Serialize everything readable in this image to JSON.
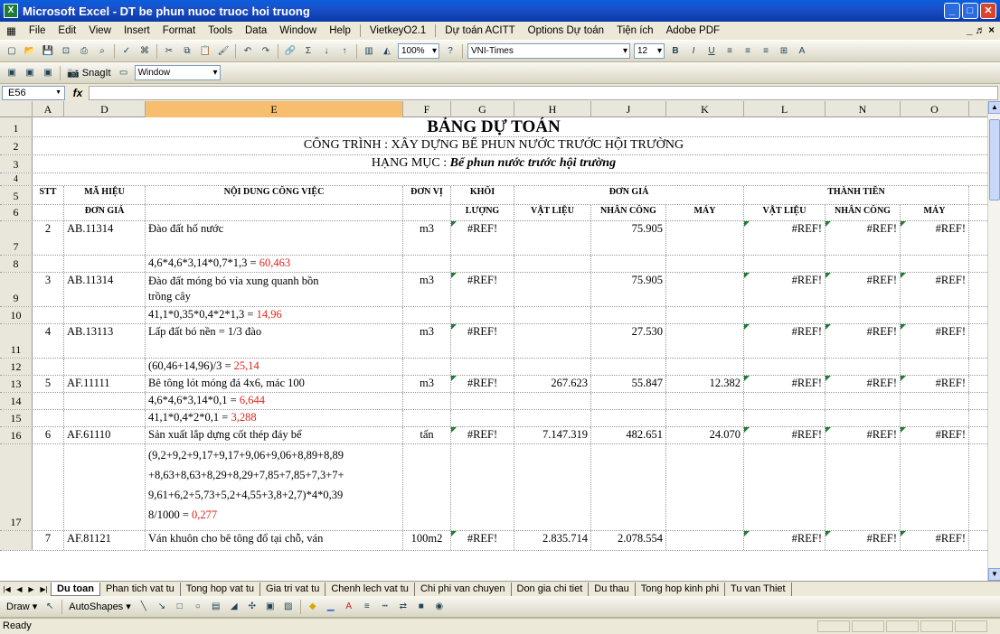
{
  "window": {
    "title": "Microsoft Excel - DT be  phun nuoc truoc hoi truong",
    "min": "_",
    "max": "□",
    "close": "✕"
  },
  "menu": [
    "File",
    "Edit",
    "View",
    "Insert",
    "Format",
    "Tools",
    "Data",
    "Window",
    "Help",
    "VietkeyO2.1",
    "Dự toán ACITT",
    "Options Dự toán",
    "Tiện ích",
    "Adobe PDF"
  ],
  "menu_right": "_ ♬ ×",
  "toolbar": {
    "zoom": "100%",
    "font": "VNI-Times",
    "size": "12",
    "bold": "B",
    "italic": "I",
    "underline": "U",
    "snagit": "SnagIt",
    "window_combo": "Window"
  },
  "formula": {
    "namebox": "E56",
    "fx": "fx",
    "value": ""
  },
  "columns": [
    "A",
    "D",
    "E",
    "F",
    "G",
    "H",
    "J",
    "K",
    "L",
    "N",
    "O"
  ],
  "rows": {
    "r1": {
      "num": "1",
      "title": "BẢNG DỰ TOÁN"
    },
    "r2": {
      "num": "2",
      "text": "CÔNG TRÌNH : XÂY DỰNG BỂ PHUN NƯỚC TRƯỚC HỘI TRƯỜNG"
    },
    "r3": {
      "num": "3",
      "label": "HẠNG MỤC : ",
      "value": "Bể phun nước trước hội trường"
    },
    "r4": {
      "num": "4"
    },
    "r5": {
      "num": "5",
      "stt": "STT",
      "mahieu": "MÃ HIỆU",
      "noidung": "NỘI DUNG CÔNG VIỆC",
      "donvi": "ĐƠN VỊ",
      "khoi": "KHỐI",
      "dongia": "ĐƠN GIÁ",
      "thanhtien": "THÀNH TIỀN"
    },
    "r6": {
      "num": "6",
      "dongia_sub": "ĐƠN GIÁ",
      "luong": "LƯỢNG",
      "vatlieu": "VẬT LIỆU",
      "nhancong": "NHÂN CÔNG",
      "may": "MÁY",
      "vatlieu2": "VẬT LIỆU",
      "nhancong2": "NHÂN CÔNG",
      "may2": "MÁY"
    },
    "r7": {
      "num": "7",
      "stt": "2",
      "ma": "AB.11314",
      "nd": "Đào đất hố nước",
      "dv": "m3",
      "kl": "#REF!",
      "vl": "",
      "nc": "75.905",
      "m": "",
      "tvl": "#REF!",
      "tnc": "#REF!",
      "tm": "#REF!"
    },
    "r8": {
      "num": "8",
      "f": "4,6*4,6*3,14*0,7*1,3 = ",
      "r": "60,463"
    },
    "r9": {
      "num": "9",
      "stt": "3",
      "ma": "AB.11314",
      "nd1": "Đào đất móng bó vỉa xung quanh bồn",
      "nd2": "trồng cây",
      "dv": "m3",
      "kl": "#REF!",
      "nc": "75.905",
      "tvl": "#REF!",
      "tnc": "#REF!",
      "tm": "#REF!"
    },
    "r10": {
      "num": "10",
      "f": "41,1*0,35*0,4*2*1,3 = ",
      "r": "14,96"
    },
    "r11": {
      "num": "11",
      "stt": "4",
      "ma": "AB.13113",
      "nd": "Lấp đất bó nền = 1/3 đào",
      "dv": "m3",
      "kl": "#REF!",
      "nc": "27.530",
      "tvl": "#REF!",
      "tnc": "#REF!",
      "tm": "#REF!"
    },
    "r12": {
      "num": "12",
      "f": "(60,46+14,96)/3 = ",
      "r": "25,14"
    },
    "r13": {
      "num": "13",
      "stt": "5",
      "ma": "AF.11111",
      "nd": "Bê tông lót móng đá 4x6, mác 100",
      "dv": "m3",
      "kl": "#REF!",
      "vl": "267.623",
      "nc": "55.847",
      "m": "12.382",
      "tvl": "#REF!",
      "tnc": "#REF!",
      "tm": "#REF!"
    },
    "r14": {
      "num": "14",
      "f": "4,6*4,6*3,14*0,1 = ",
      "r": "6,644"
    },
    "r15": {
      "num": "15",
      "f": "41,1*0,4*2*0,1 = ",
      "r": "3,288"
    },
    "r16": {
      "num": "16",
      "stt": "6",
      "ma": "AF.61110",
      "nd": "Sản xuất lắp dựng cốt thép đáy bể",
      "dv": "tấn",
      "kl": "#REF!",
      "vl": "7.147.319",
      "nc": "482.651",
      "m": "24.070",
      "tvl": "#REF!",
      "tnc": "#REF!",
      "tm": "#REF!"
    },
    "r17": {
      "num": "17",
      "l1": "(9,2+9,2+9,17+9,17+9,06+9,06+8,89+8,89",
      "l2": "+8,63+8,63+8,29+8,29+7,85+7,85+7,3+7+",
      "l3": "9,61+6,2+5,73+5,2+4,55+3,8+2,7)*4*0,39",
      "l4": "8/1000 = ",
      "r": "0,277"
    },
    "r18": {
      "num": "",
      "stt": "7",
      "ma": "AF.81121",
      "nd": "Ván khuôn cho bê tông đổ tại chỗ, ván",
      "dv": "100m2",
      "kl": "#REF!",
      "vl": "2.835.714",
      "nc": "2.078.554",
      "tvl": "#REF!",
      "tnc": "#REF!",
      "tm": "#REF!"
    }
  },
  "tabs": [
    "Du toan",
    "Phan tich vat tu",
    "Tong hop vat tu",
    "Gia tri vat tu",
    "Chenh lech vat tu",
    "Chi phi van chuyen",
    "Don gia chi tiet",
    "Du thau",
    "Tong hop kinh phi",
    "Tu van Thiet"
  ],
  "draw": {
    "draw": "Draw ▾",
    "autoshapes": "AutoShapes ▾"
  },
  "status": "Ready"
}
